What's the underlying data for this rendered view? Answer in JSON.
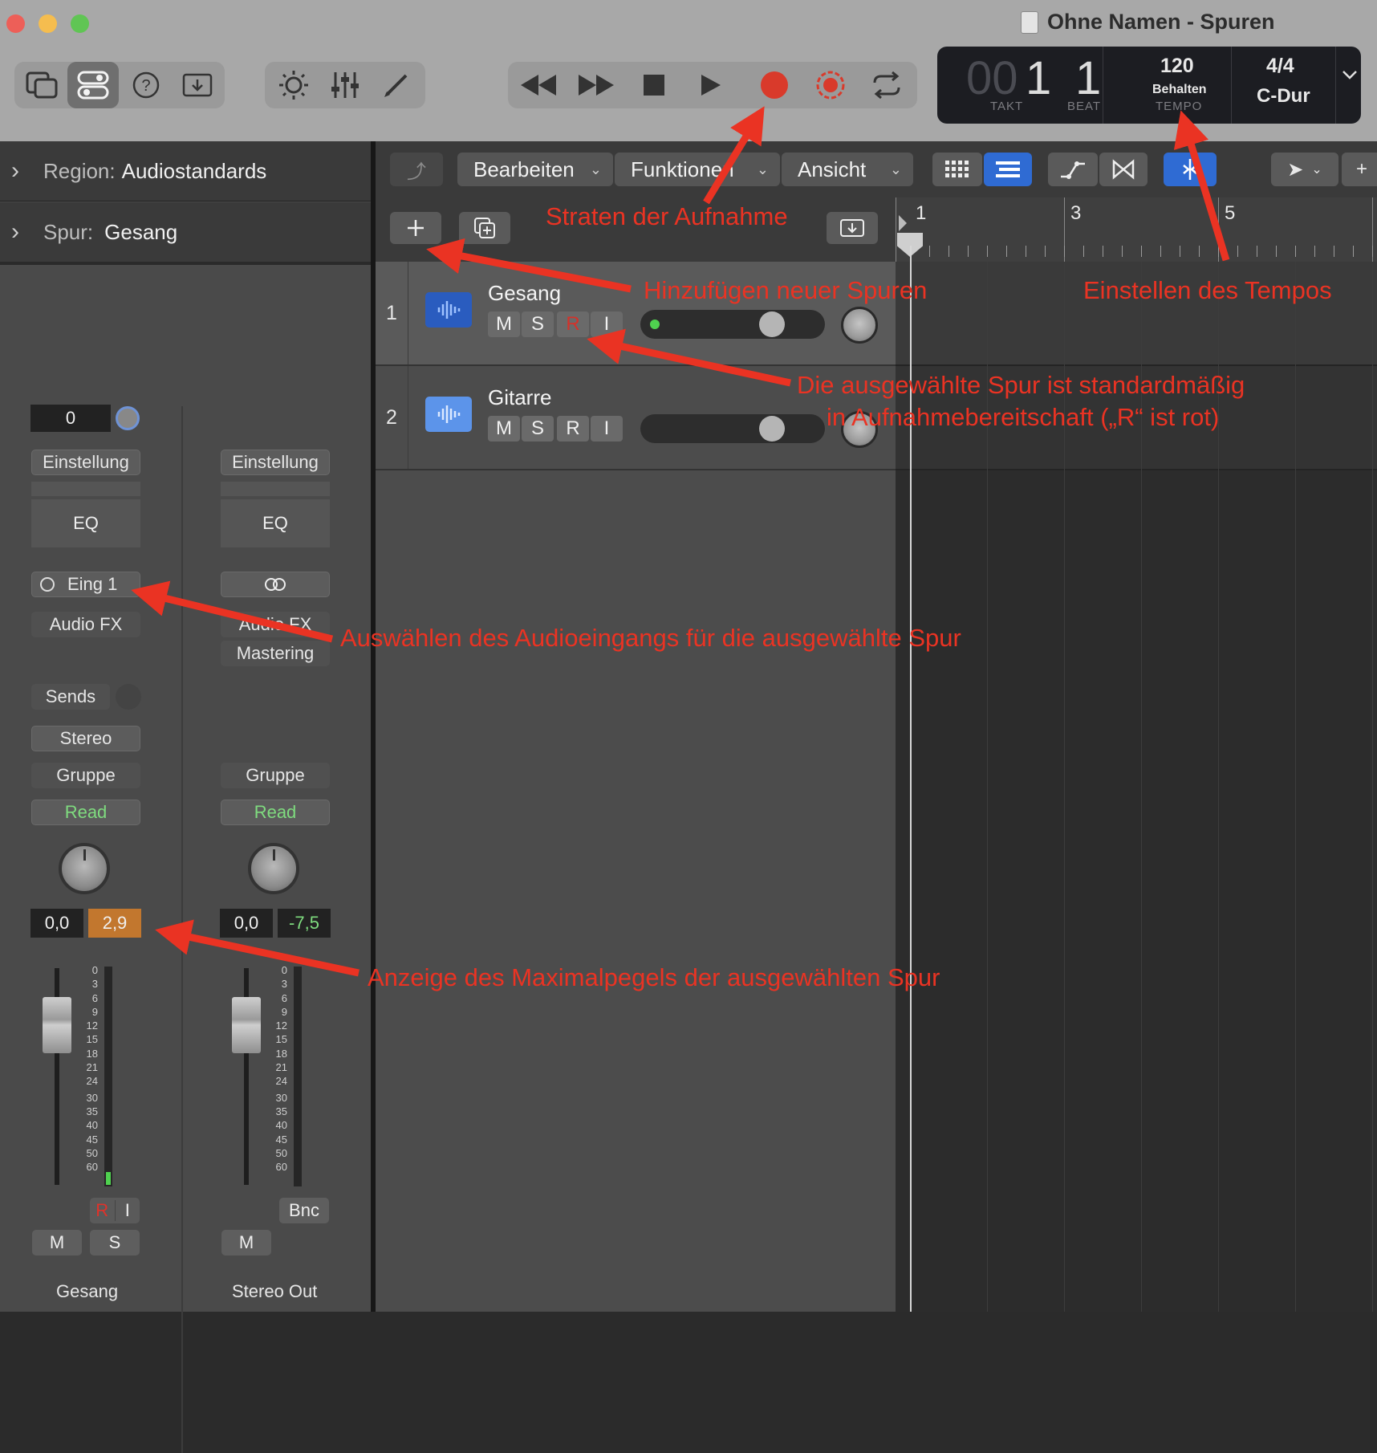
{
  "window": {
    "title": "Ohne Namen - Spuren"
  },
  "transport": {
    "rewind_icon": "rewind-icon",
    "forward_icon": "fast-forward-icon",
    "stop_icon": "stop-icon",
    "play_icon": "play-icon",
    "record_icon": "record-icon",
    "record_color": "#d93a2b"
  },
  "lcd": {
    "takt_dim": "00",
    "takt": "1",
    "beat": "1",
    "takt_label": "TAKT",
    "beat_label": "BEAT",
    "tempo": "120",
    "tempo_mode": "Behalten",
    "tempo_label": "TEMPO",
    "signature": "4/4",
    "key": "C-Dur"
  },
  "inspector": {
    "region_label": "Region:",
    "region_value": "Audiostandards",
    "track_label": "Spur:",
    "track_value": "Gesang"
  },
  "strips": [
    {
      "gain": "0",
      "setting": "Einstellung",
      "eq": "EQ",
      "input": "Eing 1",
      "audio_fx": "Audio FX",
      "sends": "Sends",
      "output": "Stereo",
      "group": "Gruppe",
      "automation": "Read",
      "volume_db": "0,0",
      "peak_db": "2,9",
      "mute": "M",
      "solo": "S",
      "rec": "R",
      "input_mon": "I",
      "name": "Gesang"
    },
    {
      "setting": "Einstellung",
      "eq": "EQ",
      "link_icon": "stereo-link-icon",
      "audio_fx": "Audio FX",
      "insert": "Mastering",
      "group": "Gruppe",
      "automation": "Read",
      "volume_db": "0,0",
      "peak_db": "-7,5",
      "bounce": "Bnc",
      "mute": "M",
      "name": "Stereo Out"
    }
  ],
  "meter_scale": [
    "0",
    "3",
    "6",
    "9",
    "12",
    "15",
    "18",
    "21",
    "24",
    "30",
    "35",
    "40",
    "45",
    "50",
    "60"
  ],
  "toolbar": {
    "edit": "Bearbeiten",
    "functions": "Funktionen",
    "view": "Ansicht"
  },
  "tracks": [
    {
      "number": "1",
      "name": "Gesang",
      "m": "M",
      "s": "S",
      "r": "R",
      "i": "I",
      "selected": true,
      "record_armed": true
    },
    {
      "number": "2",
      "name": "Gitarre",
      "m": "M",
      "s": "S",
      "r": "R",
      "i": "I",
      "selected": false,
      "record_armed": false
    }
  ],
  "ruler": {
    "bars": [
      "1",
      "3",
      "5"
    ]
  },
  "annotations": {
    "record": "Straten der Aufnahme",
    "add_track": "Hinzufügen neuer Spuren",
    "tempo": "Einstellen des Tempos",
    "armed_line1": "Die ausgewählte Spur ist standardmäßig",
    "armed_line2": "in Aufnahmebereitschaft („R“ ist rot)",
    "input": "Auswählen des Audioeingangs für die ausgewählte Spur",
    "peak": "Anzeige des Maximalpegels der ausgewählten Spur",
    "color": "#ea3323"
  }
}
